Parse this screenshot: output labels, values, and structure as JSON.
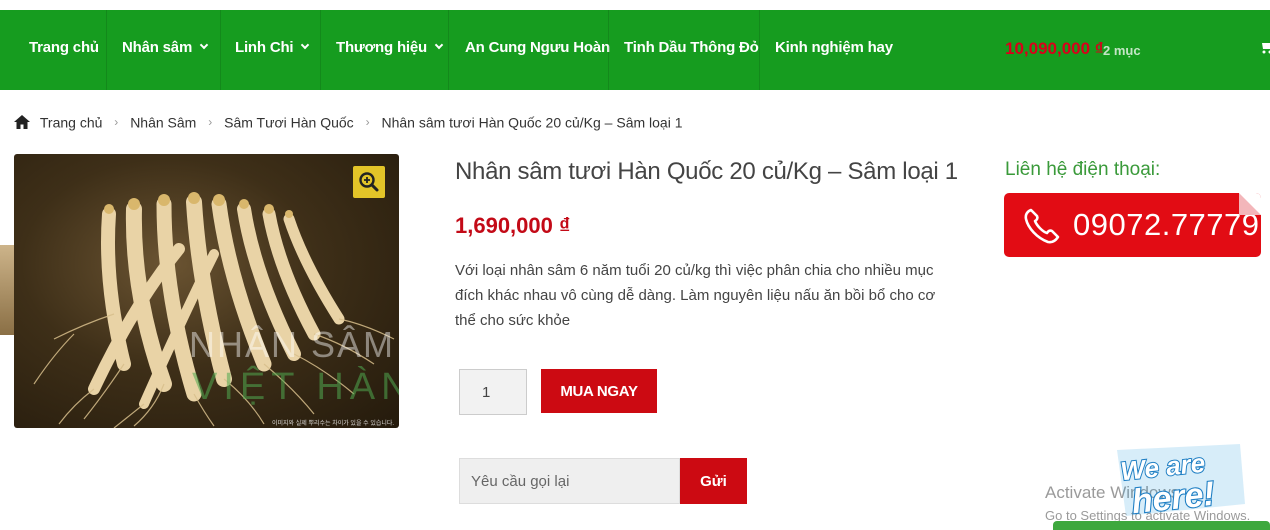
{
  "nav": {
    "items": [
      {
        "label": "Trang chủ",
        "has_dropdown": false
      },
      {
        "label": "Nhân sâm",
        "has_dropdown": true
      },
      {
        "label": "Linh Chi",
        "has_dropdown": true
      },
      {
        "label": "Thương hiệu",
        "has_dropdown": true
      },
      {
        "label": "An Cung Ngưu Hoàn",
        "has_dropdown": false
      },
      {
        "label": "Tinh Dầu Thông Đỏ",
        "has_dropdown": false
      },
      {
        "label": "Kinh nghiệm hay",
        "has_dropdown": false
      }
    ],
    "cart_amount": "10,090,000 ₫",
    "cart_count": "2 mục",
    "cart_icon": "shopping-cart-icon",
    "colors": {
      "bar": "#169c1f",
      "cart_amount": "#d9001b"
    }
  },
  "breadcrumb": {
    "home_icon": "home-icon",
    "items": [
      "Trang chủ",
      "Nhân Sâm",
      "Sâm Tươi Hàn Quốc",
      "Nhân sâm tươi Hàn Quốc 20 củ/Kg – Sâm loại 1"
    ]
  },
  "product": {
    "image": {
      "watermark_line1": "NHÂN SÂM",
      "watermark_line2": "VIỆT HÀN",
      "note": "이미지와 실제 뿌리수는 차이가 있을 수 있습니다.",
      "zoom_icon": "magnifier-zoom-icon"
    },
    "title": "Nhân sâm tươi Hàn Quốc 20 củ/Kg – Sâm loại 1",
    "price": "1,690,000 ₫",
    "description": "Với loại nhân sâm 6 năm tuổi 20 củ/kg thì việc phân chia cho nhiều mục đích khác nhau vô cùng dễ dàng. Làm nguyên liệu nấu ăn bồi bổ cho cơ thể cho sức khỏe",
    "quantity": "1",
    "buy_label": "MUA NGAY",
    "callback_placeholder": "Yêu cầu gọi lại",
    "send_label": "Gửi",
    "colors": {
      "price": "#c30a17",
      "button": "#cc0a12"
    }
  },
  "contact": {
    "label": "Liên hệ điện thoại:",
    "phone": "09072.77779",
    "phone_icon": "phone-icon",
    "color": "#e20c14"
  },
  "overlays": {
    "activate_line1": "Activate Windows",
    "activate_line2": "Go to Settings to activate Windows.",
    "chat_badge": "We are here!"
  }
}
